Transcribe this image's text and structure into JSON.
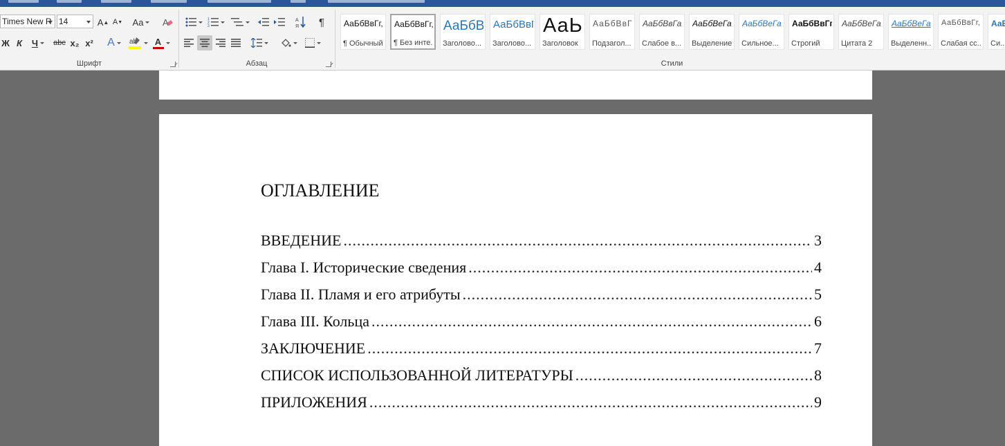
{
  "font_group": {
    "label": "Шрифт",
    "font_name": "Times New R",
    "font_size": "14",
    "grow_label": "A",
    "shrink_label": "A",
    "case_label": "Aa",
    "bold": "Ж",
    "italic": "К",
    "underline": "Ч",
    "strike": "abc",
    "subscript": "x₂",
    "superscript": "x²",
    "text_effects": "A",
    "font_color": "A"
  },
  "paragraph_group": {
    "label": "Абзац",
    "show_marks": "¶"
  },
  "styles_group": {
    "label": "Стили",
    "items": [
      {
        "sample": "АаБбВвГг,",
        "name": "¶ Обычный"
      },
      {
        "sample": "АаБбВвГг,",
        "name": "¶ Без инте..."
      },
      {
        "sample": "АаБбВı",
        "name": "Заголово..."
      },
      {
        "sample": "АаБбВвГ",
        "name": "Заголово..."
      },
      {
        "sample": "АаЬ",
        "name": "Заголовок"
      },
      {
        "sample": "АаБбВвГ",
        "name": "Подзагол..."
      },
      {
        "sample": "АаБбВвГа",
        "name": "Слабое в..."
      },
      {
        "sample": "АаБбВеГа",
        "name": "Выделение"
      },
      {
        "sample": "АаБбВеГа",
        "name": "Сильное..."
      },
      {
        "sample": "АаБбВвГг,",
        "name": "Строгий"
      },
      {
        "sample": "АаБбВеГа",
        "name": "Цитата 2"
      },
      {
        "sample": "АаБбВеГа",
        "name": "Выделенн..."
      },
      {
        "sample": "АаБбВвГг,",
        "name": "Слабая сс..."
      },
      {
        "sample": "АаБ",
        "name": "Си..."
      }
    ]
  },
  "colors": {
    "accent": "#2b579a",
    "highlight": "#ffff00",
    "font_color": "#c00000",
    "heading_blue": "#2e74b5"
  },
  "document": {
    "title": "ОГЛАВЛЕНИЕ",
    "toc": [
      {
        "text": "ВВЕДЕНИЕ",
        "page": "3"
      },
      {
        "text": "Глава I. Исторические сведения",
        "page": "4"
      },
      {
        "text": "Глава II. Пламя и его атрибуты",
        "page": "5"
      },
      {
        "text": "Глава III. Кольца",
        "page": "6"
      },
      {
        "text": "ЗАКЛЮЧЕНИЕ",
        "page": "7"
      },
      {
        "text": "СПИСОК ИСПОЛЬЗОВАННОЙ ЛИТЕРАТУРЫ",
        "page": "8"
      },
      {
        "text": "ПРИЛОЖЕНИЯ",
        "page": "9"
      }
    ]
  }
}
